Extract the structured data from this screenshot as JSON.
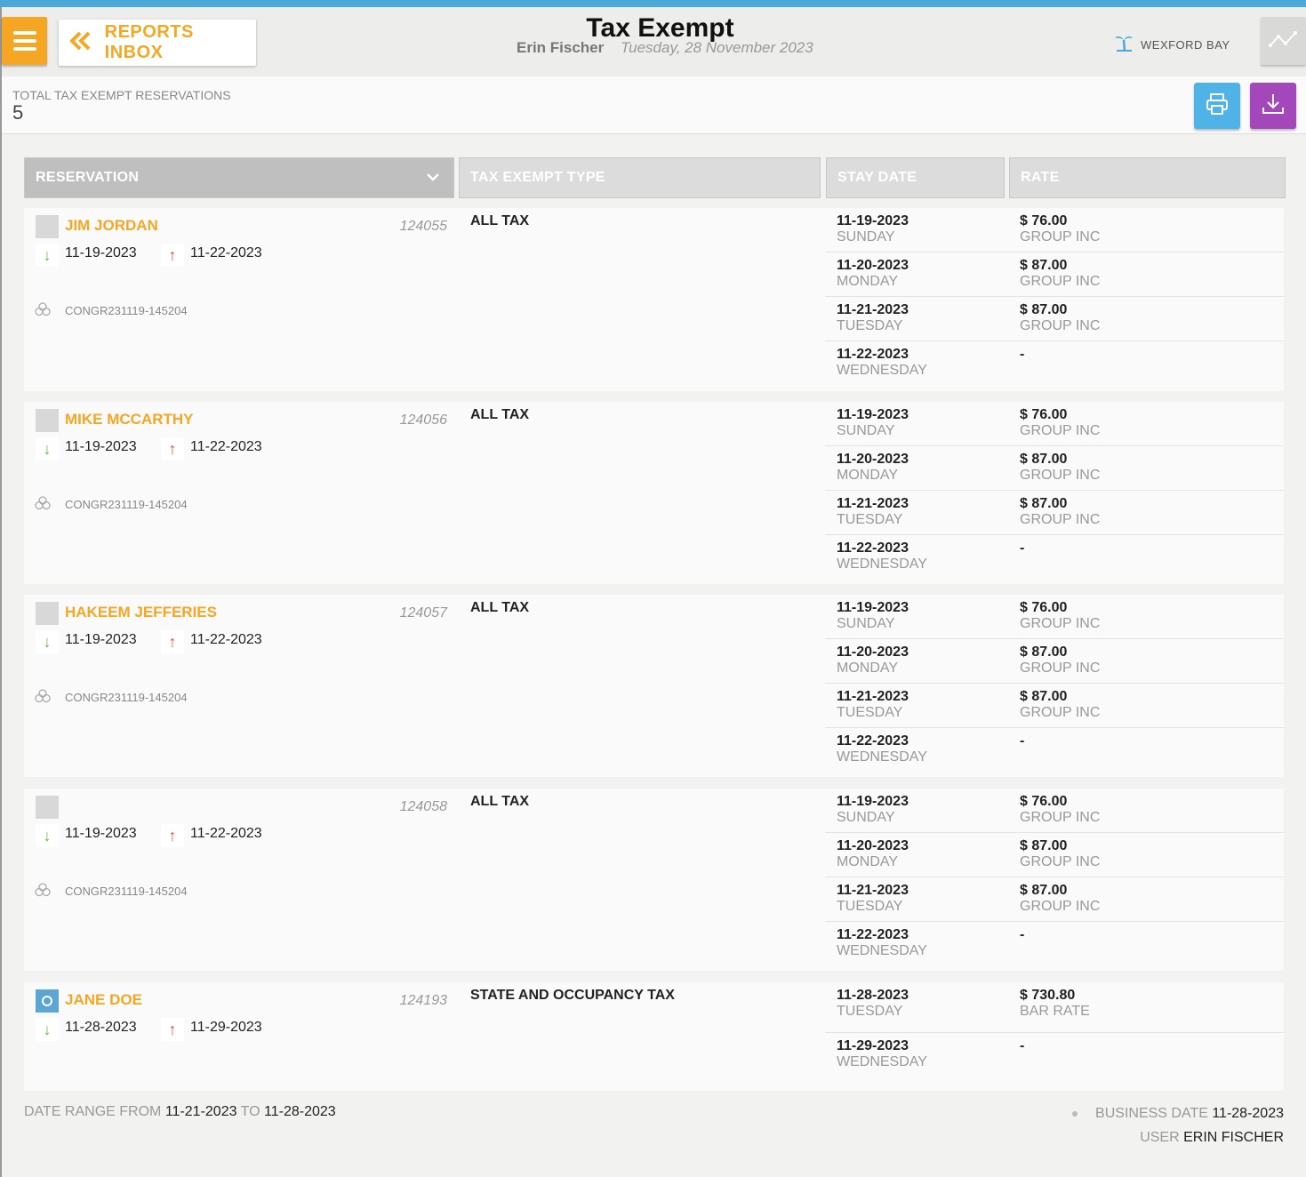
{
  "header": {
    "back_label": "REPORTS INBOX",
    "title": "Tax Exempt",
    "user": "Erin Fischer",
    "date": "Tuesday, 28 November 2023",
    "hotel": "WEXFORD BAY"
  },
  "summary": {
    "label": "TOTAL TAX EXEMPT RESERVATIONS",
    "value": "5"
  },
  "columns": [
    "RESERVATION",
    "TAX EXEMPT TYPE",
    "STAY DATE",
    "RATE"
  ],
  "reservations": [
    {
      "name": "JIM JORDAN",
      "number": "124055",
      "arrival": "11-19-2023",
      "departure": "11-22-2023",
      "group": "CONGR231119-145204",
      "tax_type": "ALL TAX",
      "nights": [
        {
          "date": "11-19-2023",
          "day": "SUNDAY",
          "rate": "$ 76.00",
          "code": "GROUP INC"
        },
        {
          "date": "11-20-2023",
          "day": "MONDAY",
          "rate": "$ 87.00",
          "code": "GROUP INC"
        },
        {
          "date": "11-21-2023",
          "day": "TUESDAY",
          "rate": "$ 87.00",
          "code": "GROUP INC"
        },
        {
          "date": "11-22-2023",
          "day": "WEDNESDAY",
          "rate": "-",
          "code": ""
        }
      ]
    },
    {
      "name": "MIKE MCCARTHY",
      "number": "124056",
      "arrival": "11-19-2023",
      "departure": "11-22-2023",
      "group": "CONGR231119-145204",
      "tax_type": "ALL TAX",
      "nights": [
        {
          "date": "11-19-2023",
          "day": "SUNDAY",
          "rate": "$ 76.00",
          "code": "GROUP INC"
        },
        {
          "date": "11-20-2023",
          "day": "MONDAY",
          "rate": "$ 87.00",
          "code": "GROUP INC"
        },
        {
          "date": "11-21-2023",
          "day": "TUESDAY",
          "rate": "$ 87.00",
          "code": "GROUP INC"
        },
        {
          "date": "11-22-2023",
          "day": "WEDNESDAY",
          "rate": "-",
          "code": ""
        }
      ]
    },
    {
      "name": "HAKEEM JEFFERIES",
      "number": "124057",
      "arrival": "11-19-2023",
      "departure": "11-22-2023",
      "group": "CONGR231119-145204",
      "tax_type": "ALL TAX",
      "nights": [
        {
          "date": "11-19-2023",
          "day": "SUNDAY",
          "rate": "$ 76.00",
          "code": "GROUP INC"
        },
        {
          "date": "11-20-2023",
          "day": "MONDAY",
          "rate": "$ 87.00",
          "code": "GROUP INC"
        },
        {
          "date": "11-21-2023",
          "day": "TUESDAY",
          "rate": "$ 87.00",
          "code": "GROUP INC"
        },
        {
          "date": "11-22-2023",
          "day": "WEDNESDAY",
          "rate": "-",
          "code": ""
        }
      ]
    },
    {
      "name": "",
      "number": "124058",
      "arrival": "11-19-2023",
      "departure": "11-22-2023",
      "group": "CONGR231119-145204",
      "tax_type": "ALL TAX",
      "nights": [
        {
          "date": "11-19-2023",
          "day": "SUNDAY",
          "rate": "$ 76.00",
          "code": "GROUP INC"
        },
        {
          "date": "11-20-2023",
          "day": "MONDAY",
          "rate": "$ 87.00",
          "code": "GROUP INC"
        },
        {
          "date": "11-21-2023",
          "day": "TUESDAY",
          "rate": "$ 87.00",
          "code": "GROUP INC"
        },
        {
          "date": "11-22-2023",
          "day": "WEDNESDAY",
          "rate": "-",
          "code": ""
        }
      ]
    },
    {
      "name": "JANE DOE",
      "number": "124193",
      "arrival": "11-28-2023",
      "departure": "11-29-2023",
      "group": "",
      "tax_type": "STATE AND OCCUPANCY TAX",
      "nights": [
        {
          "date": "11-28-2023",
          "day": "TUESDAY",
          "rate": "$ 730.80",
          "code": "BAR RATE"
        },
        {
          "date": "11-29-2023",
          "day": "WEDNESDAY",
          "rate": "-",
          "code": ""
        }
      ]
    }
  ],
  "footer": {
    "range_label": "DATE RANGE FROM",
    "range_from": "11-21-2023",
    "range_to_label": "TO",
    "range_to": "11-28-2023",
    "business_date_label": "BUSINESS DATE",
    "business_date": "11-28-2023",
    "user_label": "USER",
    "user": "ERIN FISCHER"
  }
}
